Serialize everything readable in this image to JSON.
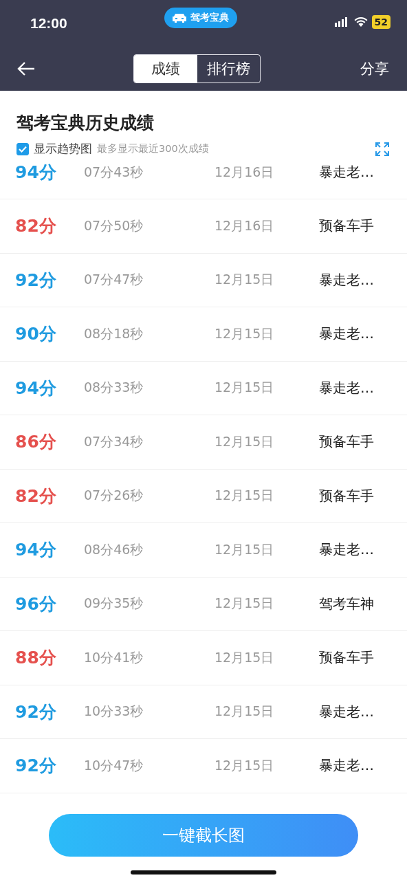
{
  "status_bar": {
    "time": "12:00",
    "app_badge": "驾考宝典",
    "battery": "52"
  },
  "nav": {
    "tabs": [
      {
        "label": "成绩",
        "selected": true
      },
      {
        "label": "排行榜",
        "selected": false
      }
    ],
    "share": "分享"
  },
  "header": {
    "title": "驾考宝典历史成绩",
    "trend_toggle": {
      "label": "显示趋势图",
      "checked": true
    },
    "note": "最多显示最近300次成绩"
  },
  "records": [
    {
      "score": "94分",
      "passed": true,
      "duration": "07分43秒",
      "date": "12月16日",
      "rank": "暴走老…"
    },
    {
      "score": "82分",
      "passed": false,
      "duration": "07分50秒",
      "date": "12月16日",
      "rank": "预备车手"
    },
    {
      "score": "92分",
      "passed": true,
      "duration": "07分47秒",
      "date": "12月15日",
      "rank": "暴走老…"
    },
    {
      "score": "90分",
      "passed": true,
      "duration": "08分18秒",
      "date": "12月15日",
      "rank": "暴走老…"
    },
    {
      "score": "94分",
      "passed": true,
      "duration": "08分33秒",
      "date": "12月15日",
      "rank": "暴走老…"
    },
    {
      "score": "86分",
      "passed": false,
      "duration": "07分34秒",
      "date": "12月15日",
      "rank": "预备车手"
    },
    {
      "score": "82分",
      "passed": false,
      "duration": "07分26秒",
      "date": "12月15日",
      "rank": "预备车手"
    },
    {
      "score": "94分",
      "passed": true,
      "duration": "08分46秒",
      "date": "12月15日",
      "rank": "暴走老…"
    },
    {
      "score": "96分",
      "passed": true,
      "duration": "09分35秒",
      "date": "12月15日",
      "rank": "驾考车神"
    },
    {
      "score": "88分",
      "passed": false,
      "duration": "10分41秒",
      "date": "12月15日",
      "rank": "预备车手"
    },
    {
      "score": "92分",
      "passed": true,
      "duration": "10分33秒",
      "date": "12月15日",
      "rank": "暴走老…"
    },
    {
      "score": "92分",
      "passed": true,
      "duration": "10分47秒",
      "date": "12月15日",
      "rank": "暴走老…"
    }
  ],
  "action_button": "一键截长图"
}
